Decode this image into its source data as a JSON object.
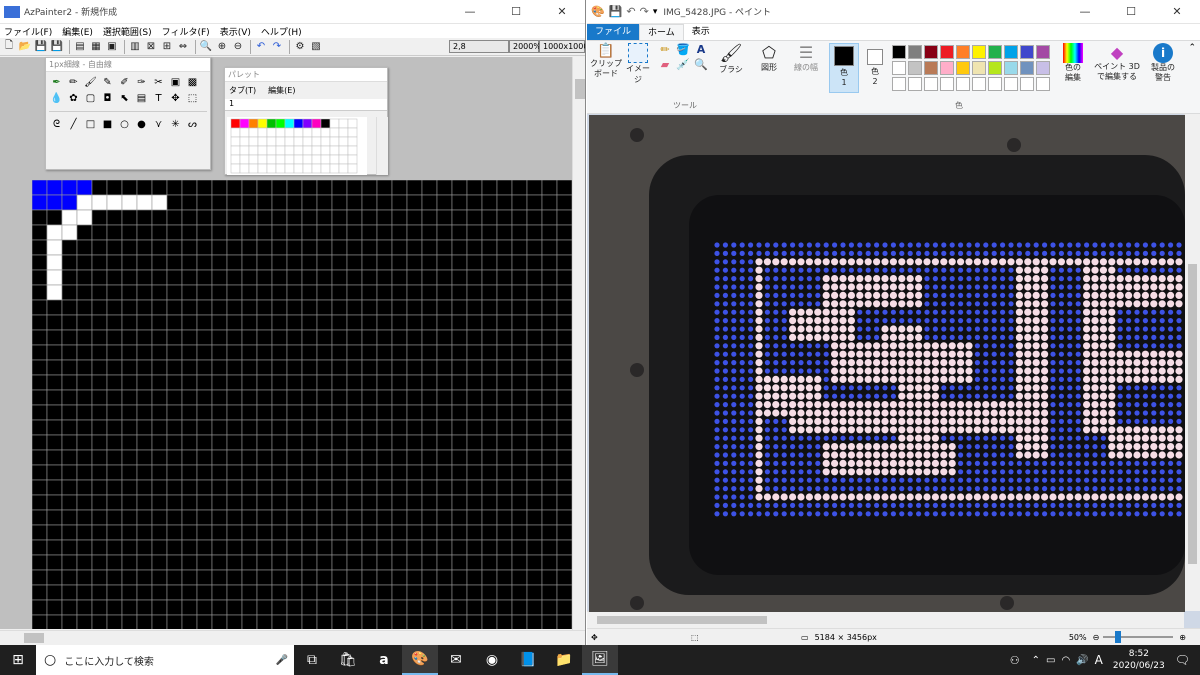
{
  "azpainter": {
    "title": "AzPainter2 - 新規作成",
    "menu": [
      "ファイル(F)",
      "編集(E)",
      "選択範囲(S)",
      "フィルタ(F)",
      "表示(V)",
      "ヘルプ(H)"
    ],
    "status": {
      "coord": "2,8",
      "zoom": "2000%",
      "size": "1000x1000"
    },
    "tool_window": {
      "title": "1px細線 - 自由線"
    },
    "palette_window": {
      "title": "パレット",
      "menu": [
        "タブ(T)",
        "編集(E)"
      ],
      "tab": "1",
      "colors": [
        "#ff0000",
        "#ff00ff",
        "#ff8000",
        "#ffff00",
        "#00c000",
        "#00ff00",
        "#00ffff",
        "#0000ff",
        "#8000ff",
        "#ff00c0",
        "#000000"
      ]
    },
    "pixel_grid": {
      "cols": 27,
      "rows": 22,
      "background": "#000000",
      "blue_cells": [
        [
          0,
          0
        ],
        [
          1,
          0
        ],
        [
          2,
          0
        ],
        [
          3,
          0
        ],
        [
          0,
          1
        ],
        [
          1,
          1
        ],
        [
          2,
          1
        ]
      ],
      "white_cells": [
        [
          3,
          1
        ],
        [
          4,
          1
        ],
        [
          5,
          1
        ],
        [
          6,
          1
        ],
        [
          7,
          1
        ],
        [
          8,
          1
        ],
        [
          3,
          2
        ],
        [
          2,
          2
        ],
        [
          2,
          3
        ],
        [
          1,
          3
        ],
        [
          2,
          3
        ],
        [
          1,
          4
        ],
        [
          1,
          5
        ],
        [
          1,
          6
        ],
        [
          1,
          7
        ]
      ]
    }
  },
  "paint": {
    "title": "IMG_5428.JPG - ペイント",
    "tabs": [
      "ファイル",
      "ホーム",
      "表示"
    ],
    "groups": {
      "clipboard": "クリップ\nボード",
      "image": "イメージ",
      "tools": "ツール",
      "brush": "ブラシ",
      "shapes": "図形",
      "line_width": "線の幅",
      "color1": "色\n1",
      "color2": "色\n2",
      "colors_label": "色",
      "edit_colors": "色の\n編集",
      "paint3d": "ペイント 3D\nで編集する",
      "product_alert": "製品の\n警告"
    },
    "color1": "#000000",
    "color2": "#ffffff",
    "palette_row1": [
      "#000000",
      "#7f7f7f",
      "#880015",
      "#ed1c24",
      "#ff7f27",
      "#fff200",
      "#22b14c",
      "#00a2e8",
      "#3f48cc",
      "#a349a4"
    ],
    "palette_row2": [
      "#ffffff",
      "#c3c3c3",
      "#b97a57",
      "#ffaec9",
      "#ffc90e",
      "#efe4b0",
      "#b5e61d",
      "#99d9ea",
      "#7092be",
      "#c8bfe7"
    ],
    "status": {
      "dimensions": "5184 × 3456px",
      "zoom": "50%"
    }
  },
  "taskbar": {
    "search_placeholder": "ここに入力して検索",
    "time": "8:52",
    "date": "2020/06/23",
    "ime": "A"
  }
}
